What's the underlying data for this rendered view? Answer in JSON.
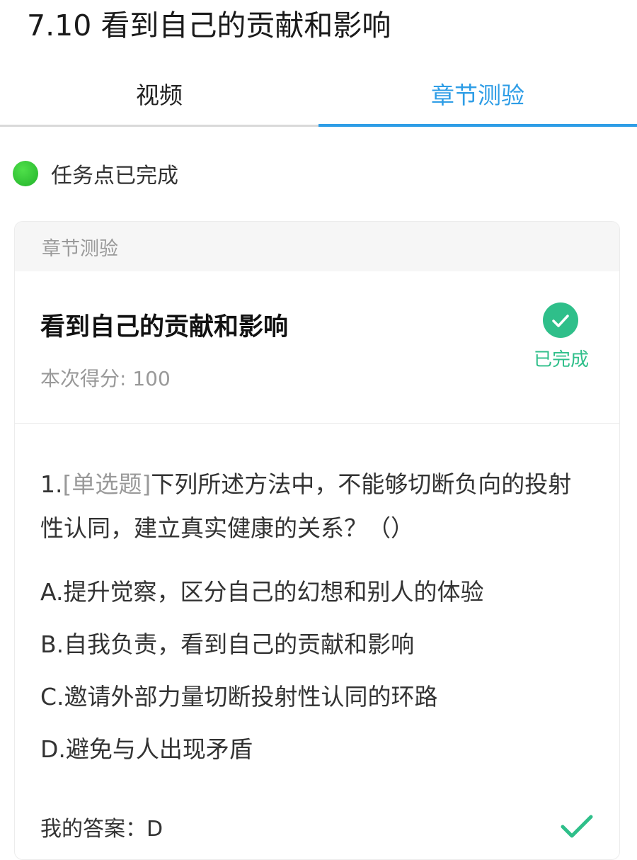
{
  "page": {
    "title": "7.10 看到自己的贡献和影响"
  },
  "tabs": [
    {
      "label": "视频"
    },
    {
      "label": "章节测验"
    }
  ],
  "status": {
    "text": "任务点已完成"
  },
  "card": {
    "header": "章节测验",
    "quiz_name": "看到自己的贡献和影响",
    "score": "本次得分: 100",
    "done_label": "已完成"
  },
  "question": {
    "number": "1.",
    "type": "[单选题]",
    "text": "下列所述方法中，不能够切断负向的投射性认同，建立真实健康的关系？（）",
    "options": [
      "A.提升觉察，区分自己的幻想和别人的体验",
      "B.自我负责，看到自己的贡献和影响",
      "C.邀请外部力量切断投射性认同的环路",
      "D.避免与人出现矛盾"
    ],
    "my_answer": "我的答案：D"
  },
  "colors": {
    "accent_blue": "#2e9de6",
    "success_green": "#2fbf8a",
    "status_dot": "#22b22a"
  },
  "icons": {
    "status": "status-dot-icon",
    "done": "check-circle-icon",
    "answer": "checkmark-icon"
  }
}
